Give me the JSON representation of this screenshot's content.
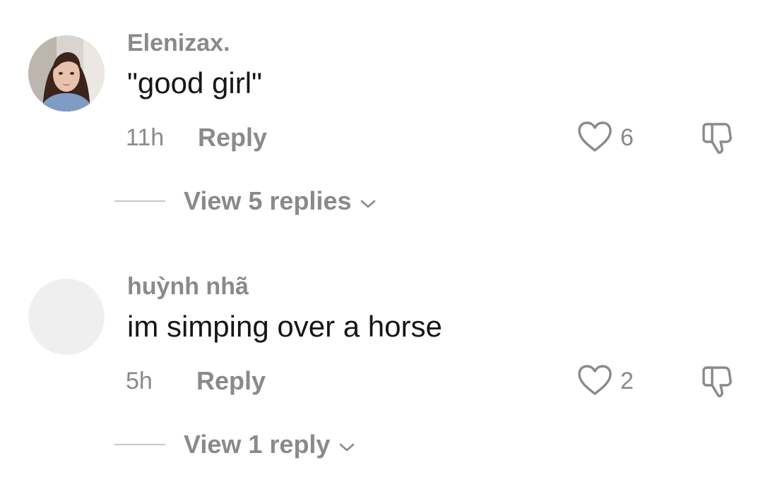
{
  "comments": [
    {
      "username": "Elenizax.",
      "text": "\"good girl\"",
      "time": "11h",
      "reply_label": "Reply",
      "likes": "6",
      "view_replies_label": "View 5 replies",
      "avatar": "profile-photo"
    },
    {
      "username": "huỳnh nhã",
      "text": "im simping over a horse",
      "time": "5h",
      "reply_label": "Reply",
      "likes": "2",
      "view_replies_label": "View 1 reply",
      "avatar": "empty-placeholder"
    }
  ],
  "icons": {
    "like": "heart-outline-icon",
    "dislike": "thumbs-down-outline-icon",
    "expand": "chevron-down-icon"
  },
  "colors": {
    "background": "#ffffff",
    "secondary_text": "#8a8a8a",
    "primary_text": "#161616",
    "avatar_placeholder": "#efefef",
    "divider": "#c8c8c8"
  }
}
